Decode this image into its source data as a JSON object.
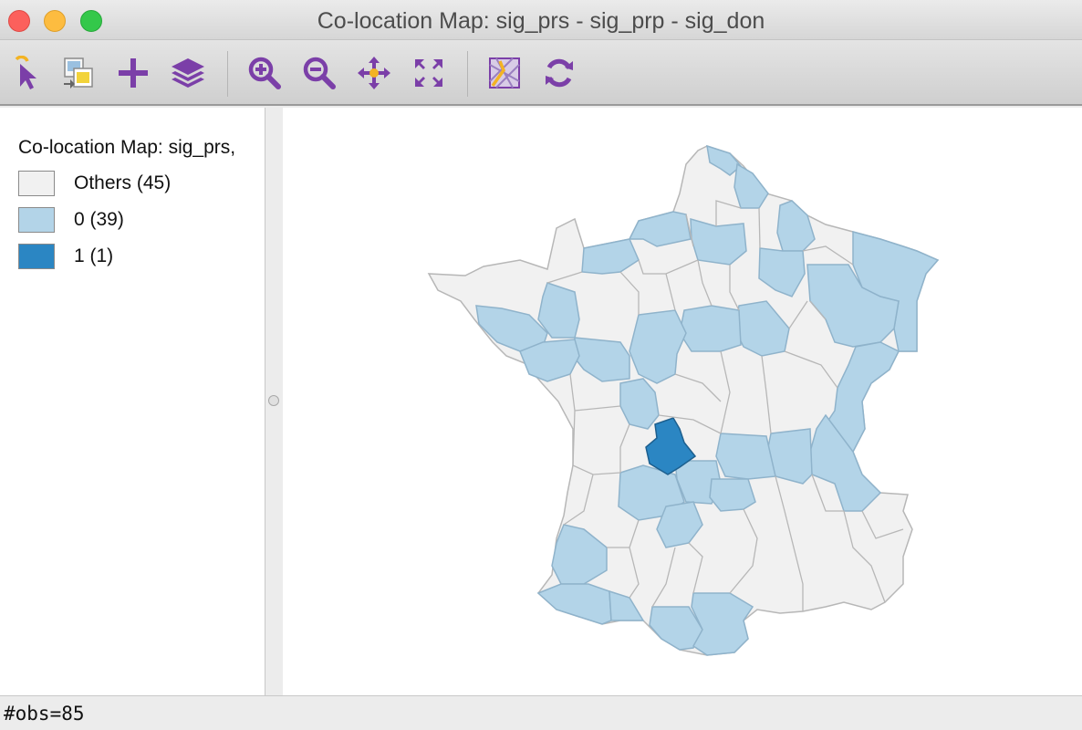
{
  "window": {
    "title": "Co-location Map: sig_prs - sig_prp - sig_don"
  },
  "toolbar": {
    "tools": [
      {
        "name": "select-icon",
        "tooltip": "Select"
      },
      {
        "name": "copy-image-icon",
        "tooltip": "Copy"
      },
      {
        "name": "add-icon",
        "tooltip": "Add"
      },
      {
        "name": "layers-icon",
        "tooltip": "Layers"
      },
      {
        "name": "zoom-in-icon",
        "tooltip": "Zoom In"
      },
      {
        "name": "zoom-out-icon",
        "tooltip": "Zoom Out"
      },
      {
        "name": "pan-icon",
        "tooltip": "Pan"
      },
      {
        "name": "fit-extent-icon",
        "tooltip": "Full Extent"
      },
      {
        "name": "basemap-icon",
        "tooltip": "Basemap"
      },
      {
        "name": "refresh-icon",
        "tooltip": "Refresh"
      }
    ],
    "icon_color": "#7b3fa8"
  },
  "legend": {
    "title": "Co-location Map: sig_prs,",
    "items": [
      {
        "label": "Others (45)",
        "color": "#f1f1f1"
      },
      {
        "label": "0 (39)",
        "color": "#b3d4e8"
      },
      {
        "label": "1 (1)",
        "color": "#2b86c3"
      }
    ]
  },
  "map": {
    "region": "France departments",
    "outline_color": "#b7b7b7",
    "category_colors": {
      "others": "#f1f1f1",
      "zero": "#b3d4e8",
      "one": "#2b86c3"
    }
  },
  "status": {
    "text": "#obs=85"
  }
}
